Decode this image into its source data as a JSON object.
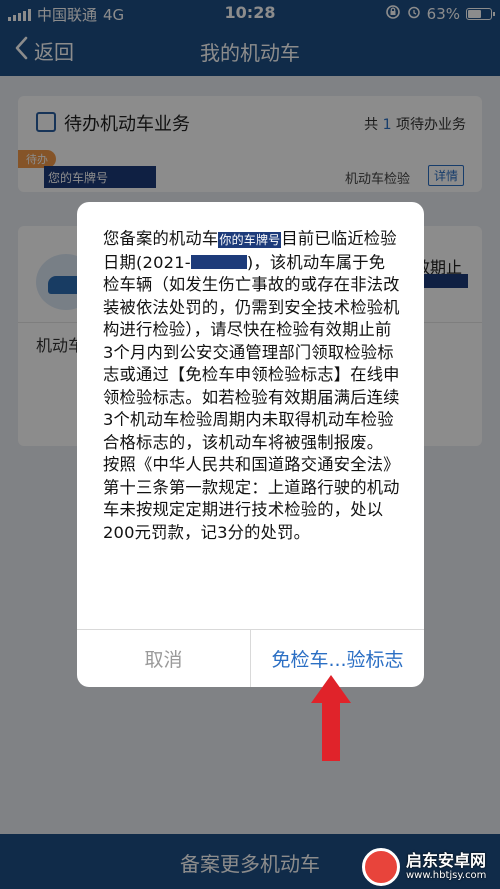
{
  "status_bar": {
    "carrier": "中国联通",
    "network": "4G",
    "time": "10:28",
    "battery": "63%",
    "battery_level": 0.63
  },
  "nav": {
    "back_label": "返回",
    "title": "我的机动车"
  },
  "pending_card": {
    "title": "待办机动车业务",
    "count_prefix": "共",
    "count": "1",
    "count_suffix": "项待办业务",
    "tag": "待办",
    "plate_placeholder": "您的车牌号",
    "business_type": "机动车检验",
    "detail_label": "详情"
  },
  "vehicle_card": {
    "partial_text_right": "效期止",
    "partial_row_label": "机动车"
  },
  "dialog": {
    "text_before_plate": "您备案的机动车",
    "plate_placeholder": "你的车牌号",
    "text_after_plate": "目前已临近检验日期(2021-",
    "text_after_date": ")，该机动车属于免检车辆（如发生伤亡事故的或存在非法改装被依法处罚的，仍需到安全技术检验机构进行检验），请尽快在检验有效期止前3个月内到公安交通管理部门领取检验标志或通过【免检车申领检验标志】在线申领检验标志。如若检验有效期届满后连续3个机动车检验周期内未取得机动车检验合格标志的，该机动车将被强制报废。",
    "law_text": "按照《中华人民共和国道路交通安全法》第十三条第一款规定：上道路行驶的机动车未按规定定期进行技术检验的，处以200元罚款，记3分的处罚。",
    "cancel_label": "取消",
    "confirm_label": "免检车...验标志"
  },
  "bottom_bar": {
    "label": "备案更多机动车"
  },
  "watermark": {
    "name": "启东安卓网",
    "url": "www.hbtjsy.com"
  },
  "colors": {
    "primary": "#1e4f86",
    "link": "#2b6fc4",
    "arrow": "#e0232a",
    "redact": "#1d3b7a"
  }
}
